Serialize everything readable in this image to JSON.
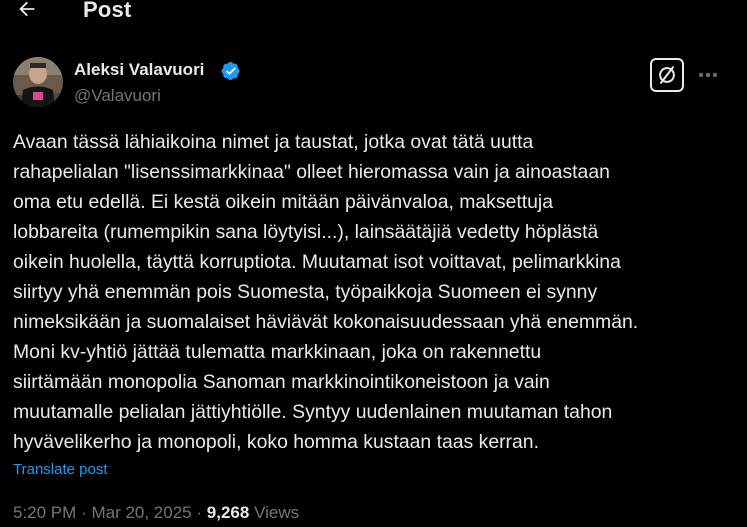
{
  "header": {
    "title": "Post",
    "back_icon": "arrow-left-icon"
  },
  "author": {
    "name": "Aleksi Valavuori",
    "handle": "@Valavuori",
    "verified": true,
    "verified_color": "#1d9bf0"
  },
  "actions": {
    "grok_icon": "grok-icon",
    "more_icon": "more-horizontal-icon"
  },
  "post": {
    "text": "Avaan tässä lähiaikoina nimet ja taustat, jotka ovat tätä uutta\nrahapelialan \"lisenssimarkkinaa\" olleet hieromassa vain ja ainoastaan\noma etu edellä. Ei kestä oikein mitään päivänvaloa, maksettuja\nlobbareita (rumempikin sana löytyisi...), lainsäätäjiä vedetty höplästä\noikein huolella, täyttä korruptiota. Muutamat isot voittavat, pelimarkkina\nsiirtyy yhä enemmän pois Suomesta, työpaikkoja Suomeen ei synny\nnimeksikään ja suomalaiset häviävät kokonaisuudessaan yhä enemmän.\nMoni kv-yhtiö jättää tulematta markkinaan, joka on rakennettu\nsiirtämään monopolia Sanoman markkinointikoneistoon ja vain\nmuutamalle pelialan jättiyhtiölle. Syntyy uudenlainen muutaman tahon\nhyvävelikerho ja monopoli, koko homma kustaan taas kerran.",
    "translate_label": "Translate post"
  },
  "meta": {
    "time": "5:20 PM",
    "separator": "·",
    "date": "Mar 20, 2025",
    "views_count": "9,268",
    "views_label": "Views"
  },
  "colors": {
    "background": "#000000",
    "text": "#e7e9ea",
    "muted": "#71767b",
    "accent": "#1d9bf0"
  }
}
